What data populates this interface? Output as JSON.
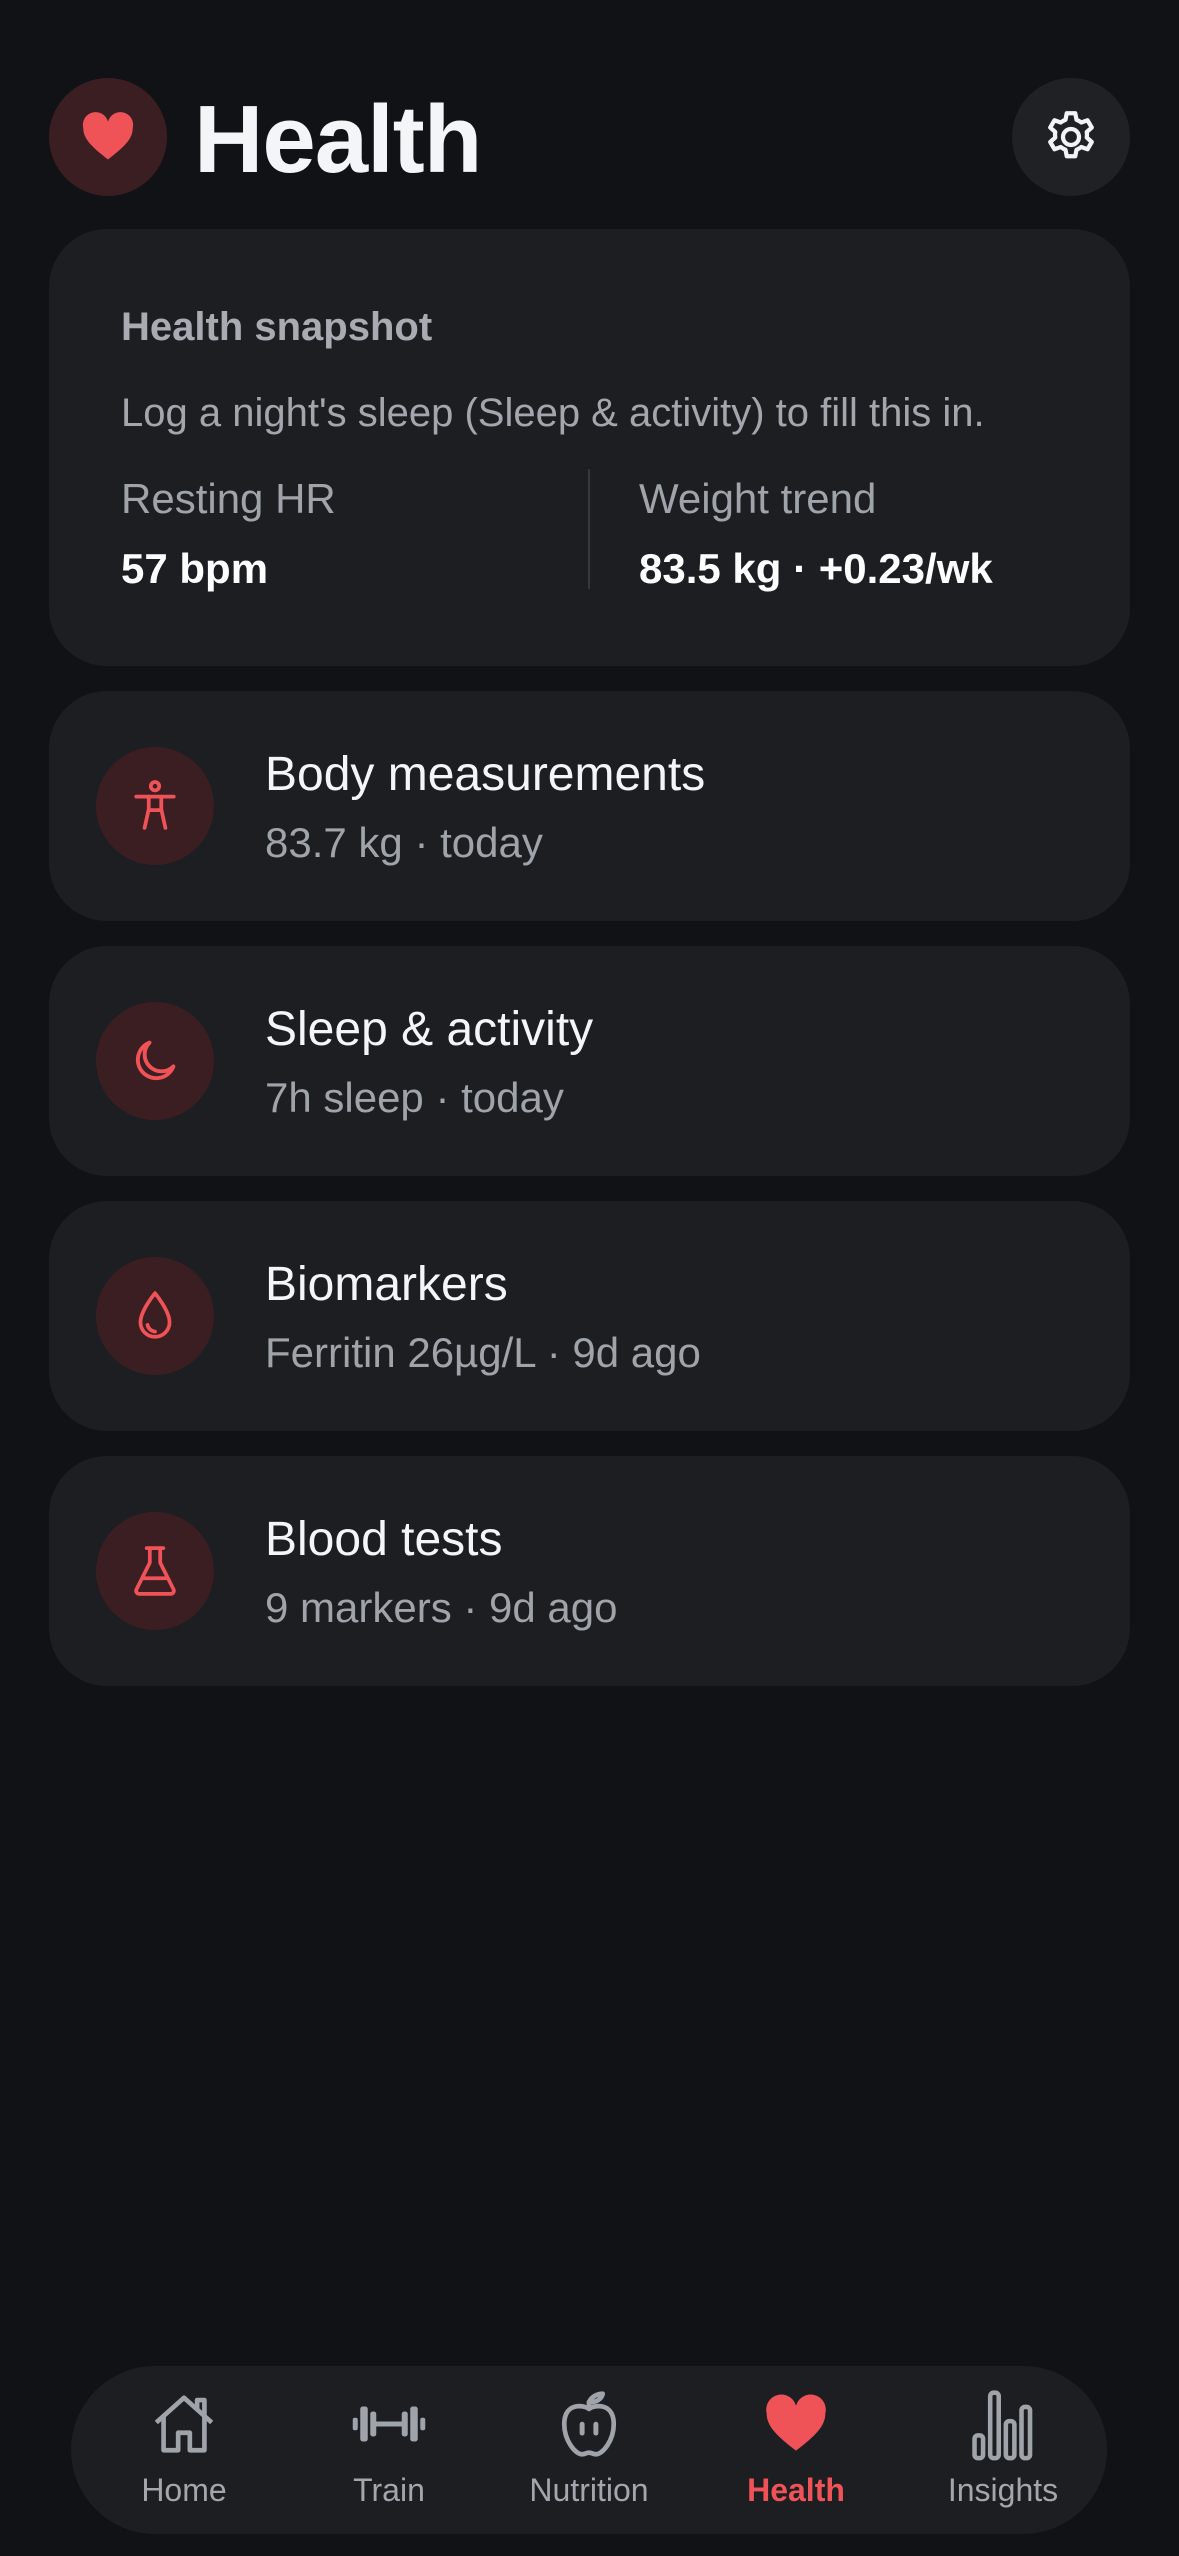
{
  "header": {
    "title": "Health",
    "app_icon": "heart-icon",
    "settings_icon": "gear-icon"
  },
  "snapshot": {
    "title": "Health snapshot",
    "description": "Log a night's sleep (Sleep & activity) to fill this in.",
    "resting_hr_label": "Resting HR",
    "resting_hr_value": "57 bpm",
    "weight_trend_label": "Weight trend",
    "weight_trend_value": "83.5 kg · +0.23/wk"
  },
  "items": [
    {
      "title": "Body measurements",
      "subtitle": "83.7 kg · today",
      "icon": "body-icon"
    },
    {
      "title": "Sleep & activity",
      "subtitle": "7h sleep · today",
      "icon": "moon-icon"
    },
    {
      "title": "Biomarkers",
      "subtitle": "Ferritin 26µg/L · 9d ago",
      "icon": "drop-icon"
    },
    {
      "title": "Blood tests",
      "subtitle": "9 markers · 9d ago",
      "icon": "flask-icon"
    }
  ],
  "nav": [
    {
      "label": "Home",
      "icon": "home-icon"
    },
    {
      "label": "Train",
      "icon": "dumbbell-icon"
    },
    {
      "label": "Nutrition",
      "icon": "apple-icon"
    },
    {
      "label": "Health",
      "icon": "heart-icon",
      "active": true
    },
    {
      "label": "Insights",
      "icon": "bar-chart-icon"
    }
  ],
  "colors": {
    "accent": "#ef5358",
    "background": "#111215",
    "card": "#1c1e22",
    "icon_bg": "#3b1e22"
  }
}
